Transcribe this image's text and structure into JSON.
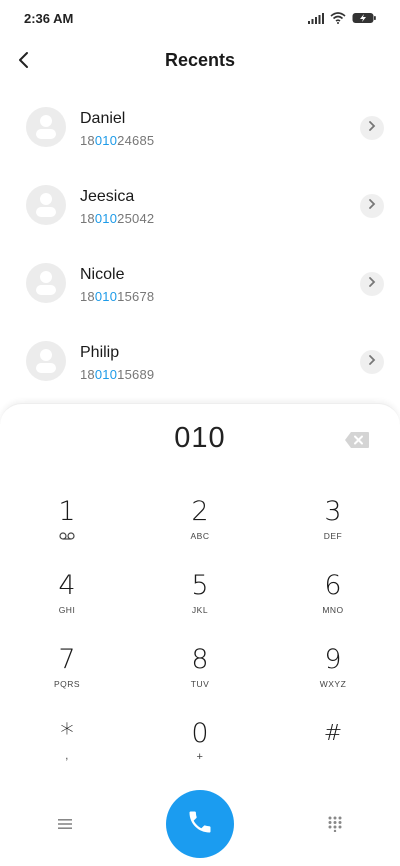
{
  "status": {
    "time": "2:36 AM",
    "icons": [
      "signal-icon",
      "wifi-icon",
      "battery-charging-icon"
    ]
  },
  "header": {
    "title": "Recents",
    "back_icon": "back-arrow-icon"
  },
  "recents": [
    {
      "name": "Daniel",
      "number_prefix": "18",
      "number_match": "010",
      "number_suffix": "24685"
    },
    {
      "name": "Jeesica",
      "number_prefix": "18",
      "number_match": "010",
      "number_suffix": "25042"
    },
    {
      "name": "Nicole",
      "number_prefix": "18",
      "number_match": "010",
      "number_suffix": "15678"
    },
    {
      "name": "Philip",
      "number_prefix": "18",
      "number_match": "010",
      "number_suffix": "15689"
    }
  ],
  "dialpad": {
    "entered_number": "010",
    "keys": [
      {
        "digit": "1",
        "letters": ""
      },
      {
        "digit": "2",
        "letters": "ABC"
      },
      {
        "digit": "3",
        "letters": "DEF"
      },
      {
        "digit": "4",
        "letters": "GHI"
      },
      {
        "digit": "5",
        "letters": "JKL"
      },
      {
        "digit": "6",
        "letters": "MNO"
      },
      {
        "digit": "7",
        "letters": "PQRS"
      },
      {
        "digit": "8",
        "letters": "TUV"
      },
      {
        "digit": "9",
        "letters": "WXYZ"
      },
      {
        "digit": "*",
        "letters": ","
      },
      {
        "digit": "0",
        "letters": "+"
      },
      {
        "digit": "#",
        "letters": ""
      }
    ]
  },
  "colors": {
    "accent": "#1e9be8",
    "call_button": "#1b9cf0"
  }
}
